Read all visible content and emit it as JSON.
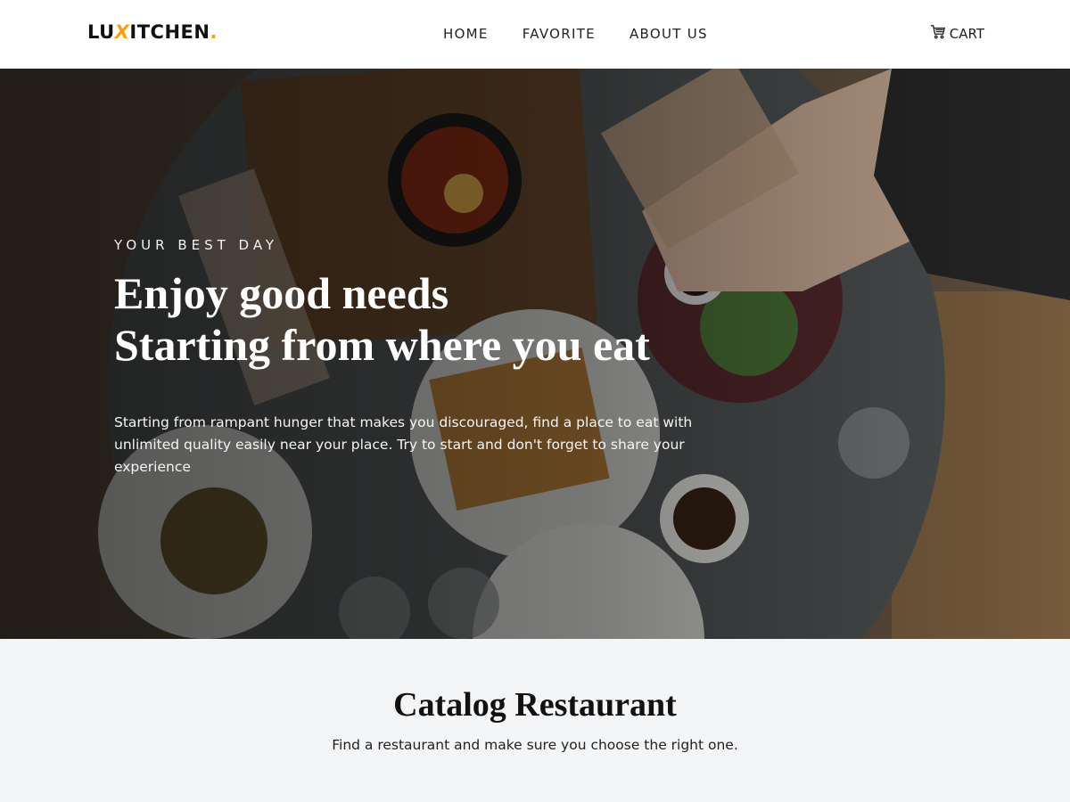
{
  "brand": {
    "name_prefix": "LU",
    "name_x": "X",
    "name_suffix": "ITCHEN",
    "dot": ".",
    "accent": "#ff9f0d"
  },
  "nav": {
    "items": [
      {
        "label": "HOME"
      },
      {
        "label": "FAVORITE"
      },
      {
        "label": "ABOUT US"
      }
    ],
    "cart_label": "CART",
    "cart_icon": "cart-icon"
  },
  "hero": {
    "eyebrow": "YOUR BEST DAY",
    "headline_line1": "Enjoy good needs",
    "headline_line2": "Starting from where you eat",
    "description": "Starting from rampant hunger that makes you discouraged, find a place to eat with unlimited quality easily near your place. Try to start and don't forget to share your experience"
  },
  "catalog": {
    "title": "Catalog Restaurant",
    "subtitle": "Find a restaurant and make sure you choose the right one."
  }
}
